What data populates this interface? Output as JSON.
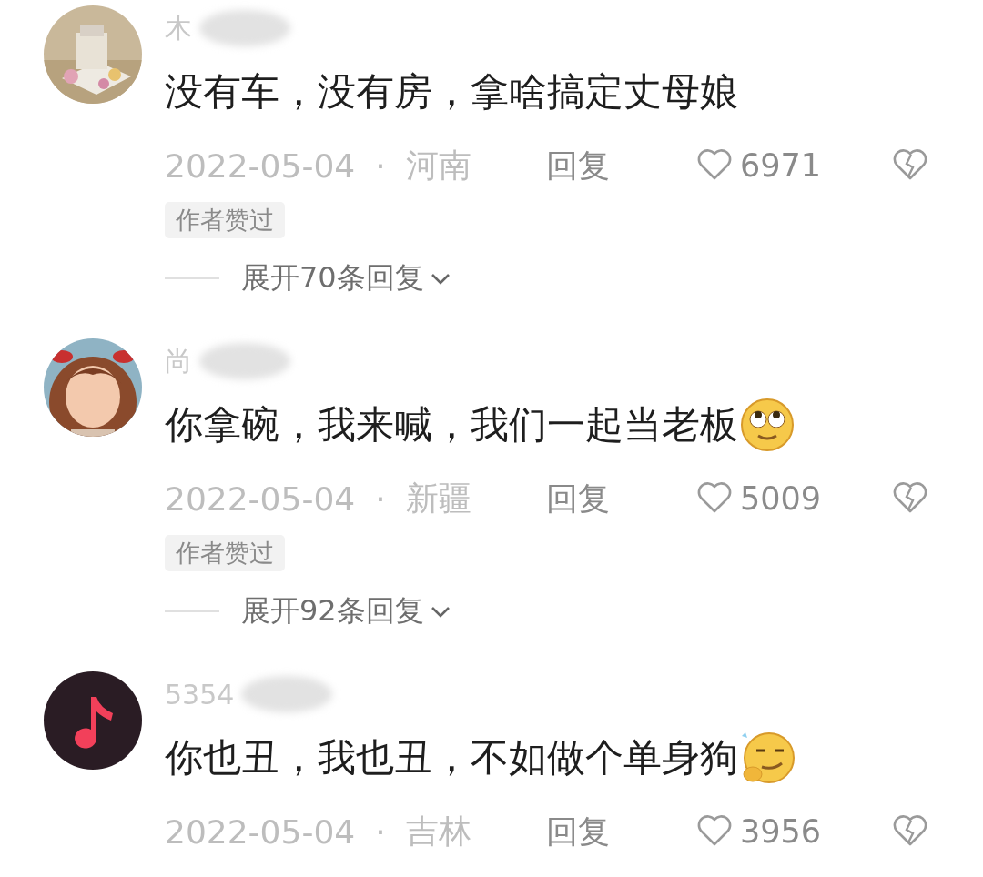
{
  "comments": [
    {
      "username": "木",
      "comment": "没有车，没有房，拿啥搞定丈母娘",
      "date": "2022-05-04",
      "dot": "·",
      "location": "河南",
      "reply": "回复",
      "likes": "6971",
      "badge": "作者赞过",
      "expand": "展开70条回复"
    },
    {
      "avatar": {
        "kind": "cartoon"
      },
      "username": "尚",
      "comment": "你拿碗，我来喊，我们一起当老板",
      "emoji": {
        "kind": "rolling-eyes"
      },
      "date": "2022-05-04",
      "dot": "·",
      "location": "新疆",
      "reply": "回复",
      "likes": "5009",
      "badge": "作者赞过",
      "expand": "展开92条回复"
    },
    {
      "avatar": {
        "kind": "music-note"
      },
      "username": "5354",
      "comment": "你也丑，我也丑，不如做个单身狗",
      "emoji": {
        "kind": "smirk"
      },
      "date": "2022-05-04",
      "dot": "·",
      "location": "吉林",
      "reply": "回复",
      "likes": "3956"
    }
  ]
}
